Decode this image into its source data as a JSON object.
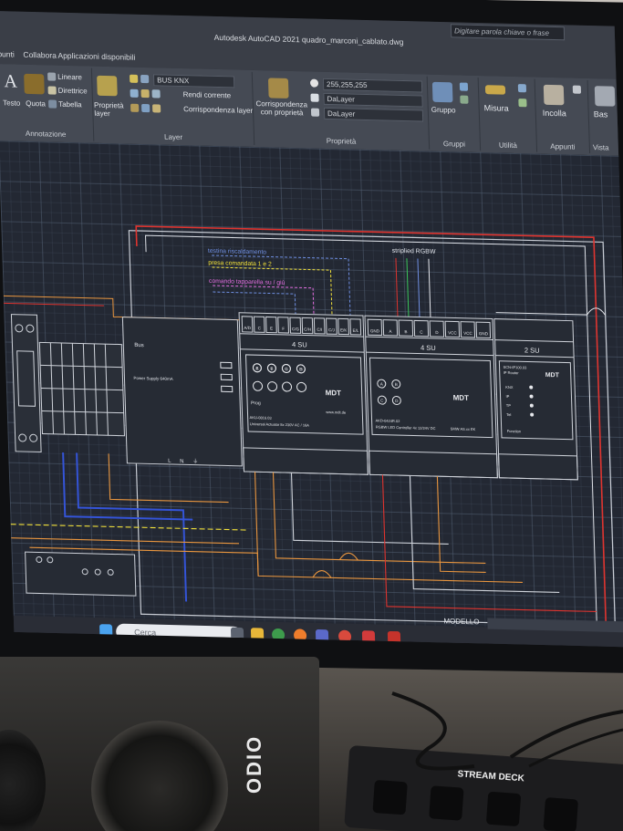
{
  "app": {
    "title": "Autodesk AutoCAD 2021  quadro_marconi_cablato.dwg",
    "search_placeholder": "Digitare parola chiave o frase"
  },
  "ribbon_tabs": [
    "ipunti",
    "Collabora",
    "Applicazioni disponibili"
  ],
  "ribbon": {
    "annotation": {
      "label": "Annotazione",
      "testo": "Testo",
      "quota": "Quota",
      "lineare": "Lineare",
      "direttrice": "Direttrice",
      "tabella": "Tabella"
    },
    "layer": {
      "label": "Layer",
      "proprieta_layer": "Proprietà layer",
      "current_layer": "BUS KNX",
      "rendi_corrente": "Rendi corrente",
      "corrispondenza_layer": "Corrispondenza layer"
    },
    "properties": {
      "label": "Proprietà",
      "corrispondenza": "Corrispondenza con proprietà",
      "color": "255,255,255",
      "linetype": "DaLayer",
      "lineweight": "DaLayer"
    },
    "groups": {
      "label": "Gruppi",
      "gruppo": "Gruppo"
    },
    "utilities": {
      "label": "Utilità",
      "misura": "Misura"
    },
    "clipboard": {
      "label": "Appunti",
      "incolla": "Incolla"
    },
    "view": {
      "label": "Vista",
      "base": "Bas"
    }
  },
  "drawing": {
    "legend": [
      "testina riscaldamento",
      "presa comandata 1 e 2",
      "comando tapparella su / giù"
    ],
    "strip_label": "striplied RGBW",
    "power_supply": {
      "bus": "Bus",
      "desc": "Power Supply 640mA",
      "terminals": [
        "L",
        "N",
        "⏚"
      ]
    },
    "actuator": {
      "units": "4 SU",
      "terminal_labels": [
        "A/D",
        "C",
        "E",
        "F",
        "C/G",
        "C/H",
        "C/I",
        "C/J",
        "E/K",
        "E/L"
      ],
      "code": "AKU-0816.03",
      "desc": "Universal Actuator 8x 230V AC / 16A",
      "brand": "MDT",
      "site": "www.mdt.de",
      "prog": "Prog",
      "channels": [
        "A",
        "B",
        "C",
        "D",
        "E",
        "F",
        "G",
        "H"
      ]
    },
    "led_controller": {
      "units": "4 SU",
      "terminal_labels": [
        "GND",
        "A",
        "B",
        "C",
        "D",
        "VCC",
        "VCC",
        "GND"
      ],
      "code": "AKD-0424R.02",
      "desc": "RGBW LED Controller 4x 12/24V DC",
      "model": "SMW AS.xx EK",
      "brand": "MDT",
      "channels": [
        "A",
        "B",
        "C",
        "D"
      ]
    },
    "router": {
      "units": "2 SU",
      "code": "SCN-IP100.03",
      "desc": "IP Router",
      "brand": "MDT",
      "leds": [
        "KNX",
        "IP",
        "TP",
        "Tel"
      ],
      "functions": "Function"
    }
  },
  "statusbar": {
    "model_tab": "MODELLO"
  },
  "taskbar": {
    "search": "Cerca"
  },
  "desk": {
    "stream_deck": "STREAM DECK",
    "speaker_brand": "ODIO"
  }
}
